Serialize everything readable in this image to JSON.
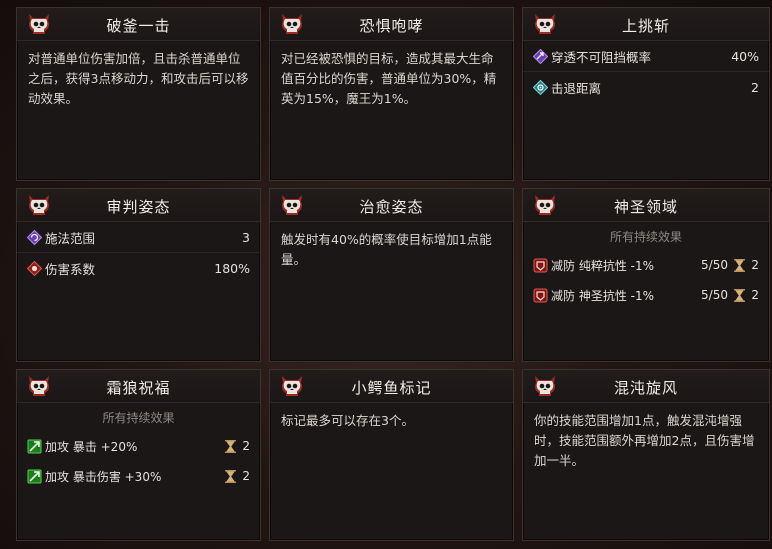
{
  "colors": {
    "card_bg": "#1b1716",
    "accent_red": "#c0392b",
    "accent_purple": "#8e5bd6",
    "accent_teal": "#4fb3b8",
    "accent_green": "#35a835",
    "hourglass": "#d6b37a"
  },
  "cards": [
    {
      "title": "破釜一击",
      "desc": "对普通单位伤害加倍，且击杀普通单位之后，获得3点移动力，和攻击后可以移动效果。"
    },
    {
      "title": "恐惧咆哮",
      "desc": "对已经被恐惧的目标，造成其最大生命值百分比的伤害，普通单位为30%，精英为15%，魔王为1%。"
    },
    {
      "title": "上挑斩",
      "stats": [
        {
          "icon": "purple-pierce-icon",
          "label": "穿透不可阻挡概率",
          "value": "40%"
        },
        {
          "icon": "teal-knockback-icon",
          "label": "击退距离",
          "value": "2"
        }
      ]
    },
    {
      "title": "审判姿态",
      "stats": [
        {
          "icon": "purple-range-icon",
          "label": "施法范围",
          "value": "3"
        },
        {
          "icon": "red-damage-icon",
          "label": "伤害系数",
          "value": "180%"
        }
      ]
    },
    {
      "title": "治愈姿态",
      "desc": "触发时有40%的概率使目标增加1点能量。"
    },
    {
      "title": "神圣领域",
      "sub_head": "所有持续效果",
      "effects": [
        {
          "icon": "red-debuff-icon",
          "label": "减防 纯粹抗性 -1%",
          "value": "5/50",
          "turns": "2"
        },
        {
          "icon": "red-debuff-icon",
          "label": "减防 神圣抗性 -1%",
          "value": "5/50",
          "turns": "2"
        }
      ]
    },
    {
      "title": "霜狼祝福",
      "sub_head": "所有持续效果",
      "effects": [
        {
          "icon": "green-buff-icon",
          "label": "加攻 暴击 +20%",
          "value": "",
          "turns": "2"
        },
        {
          "icon": "green-buff-icon",
          "label": "加攻 暴击伤害 +30%",
          "value": "",
          "turns": "2"
        }
      ]
    },
    {
      "title": "小鳄鱼标记",
      "desc": "标记最多可以存在3个。"
    },
    {
      "title": "混沌旋风",
      "desc": "你的技能范围增加1点，触发混沌增强时，技能范围额外再增加2点，且伤害增加一半。"
    }
  ]
}
